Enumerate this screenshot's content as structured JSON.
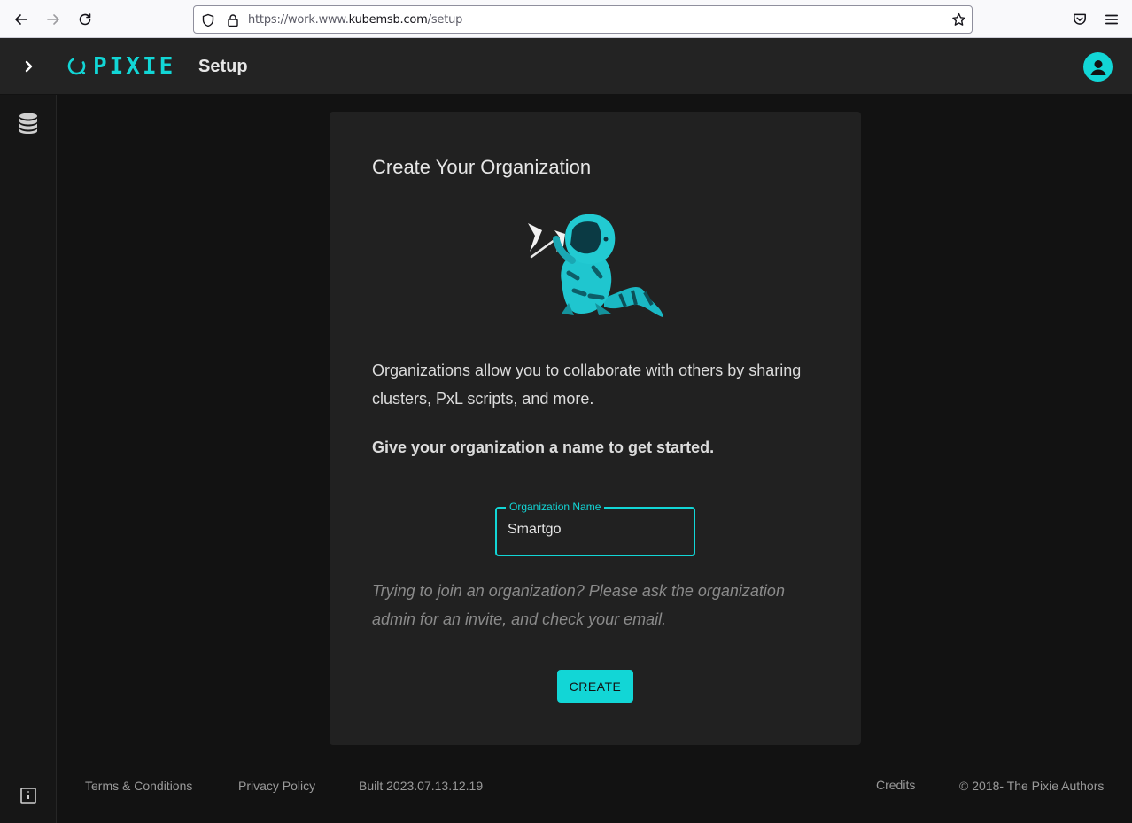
{
  "browser": {
    "url_prefix": "https://work.www.",
    "url_host": "kubemsb.com",
    "url_path": "/setup"
  },
  "app": {
    "logo_text": "PIXIE",
    "page_title": "Setup"
  },
  "card": {
    "title": "Create Your Organization",
    "description": "Organizations allow you to collaborate with others by sharing clusters, PxL scripts, and more.",
    "call_to_action": "Give your organization a name to get started.",
    "field_label": "Organization Name",
    "field_value": "Smartgo",
    "hint": "Trying to join an organization? Please ask the organization admin for an invite, and check your email.",
    "create_label": "CREATE"
  },
  "footer": {
    "terms": "Terms & Conditions",
    "privacy": "Privacy Policy",
    "build": "Built 2023.07.13.12.19",
    "credits": "Credits",
    "copyright": "© 2018- The Pixie Authors"
  },
  "colors": {
    "accent": "#12d6d6",
    "background": "#121212",
    "card": "#212121",
    "topbar": "#232323"
  }
}
